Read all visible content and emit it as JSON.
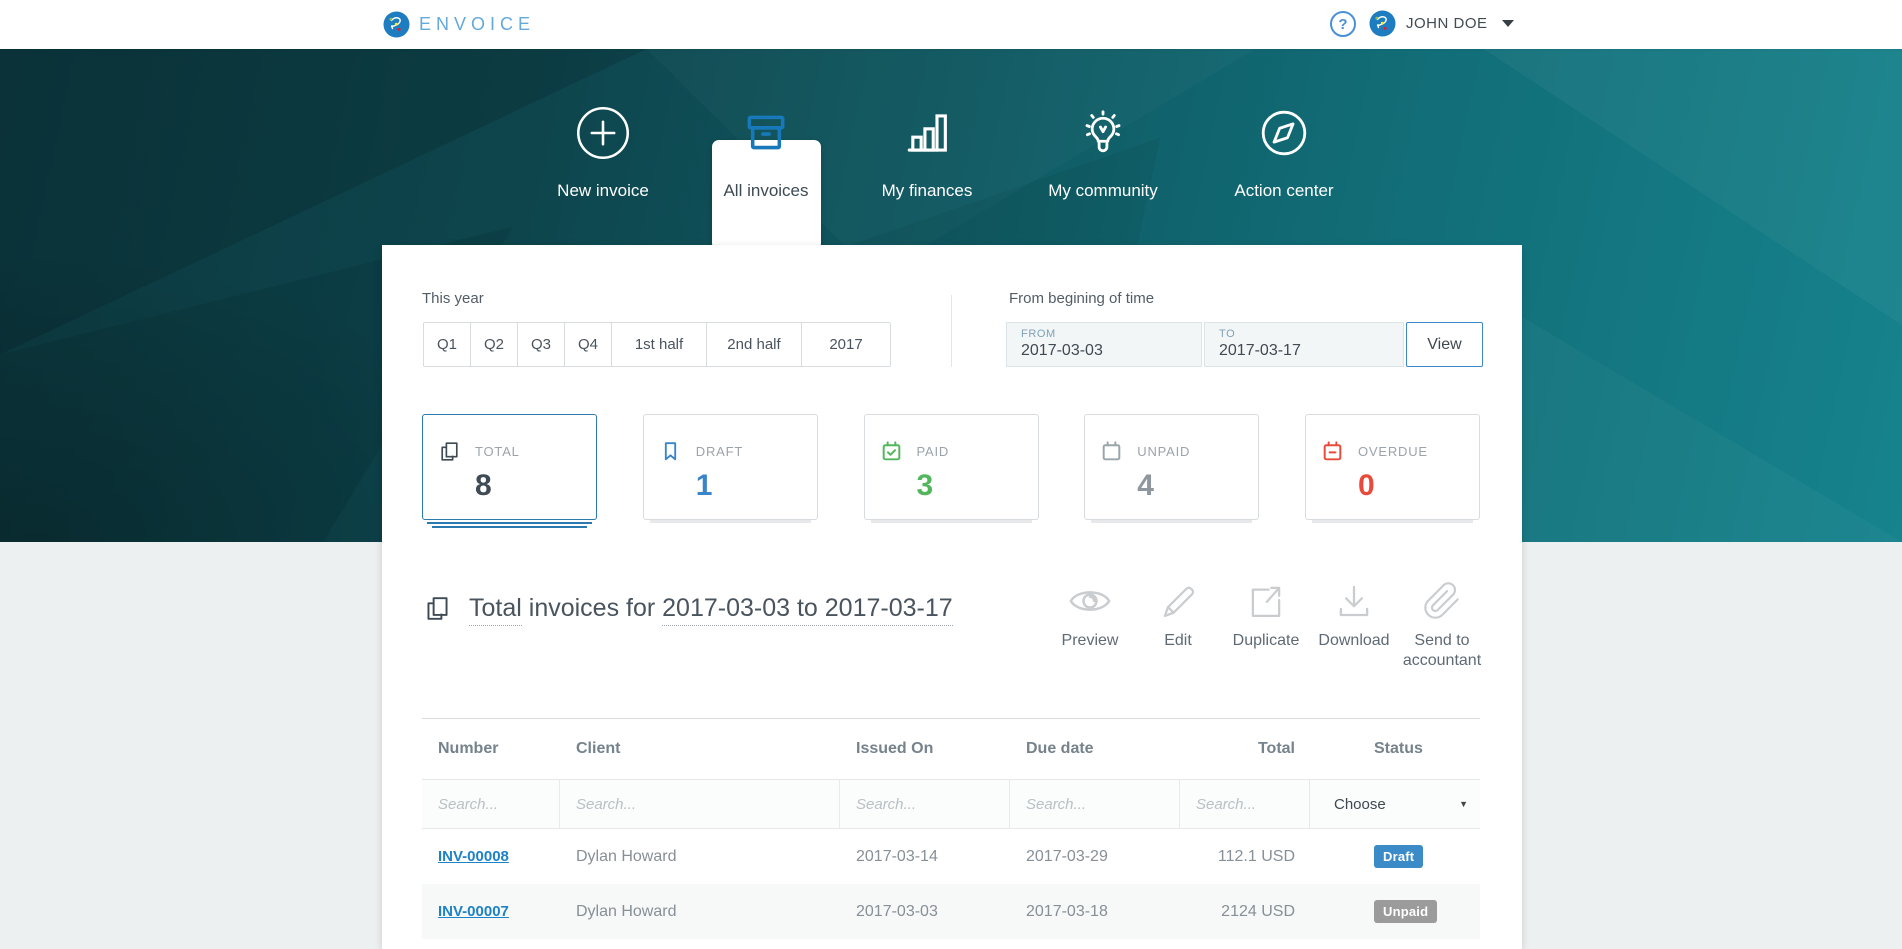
{
  "header": {
    "brand": "ENVOICE",
    "help_icon": "?",
    "user_name": "JOHN DOE"
  },
  "nav": {
    "items": [
      {
        "label": "New invoice",
        "icon": "plus-circle-icon",
        "active": false
      },
      {
        "label": "All invoices",
        "icon": "archive-box-icon",
        "active": true
      },
      {
        "label": "My finances",
        "icon": "bar-chart-icon",
        "active": false
      },
      {
        "label": "My community",
        "icon": "lightbulb-icon",
        "active": false
      },
      {
        "label": "Action center",
        "icon": "compass-icon",
        "active": false
      }
    ]
  },
  "filters": {
    "preset_label": "This year",
    "periods": [
      "Q1",
      "Q2",
      "Q3",
      "Q4",
      "1st half",
      "2nd half",
      "2017"
    ],
    "range_label": "From begining of time",
    "from": {
      "label": "FROM",
      "value": "2017-03-03"
    },
    "to": {
      "label": "TO",
      "value": "2017-03-17"
    },
    "view_button": "View"
  },
  "summary_cards": [
    {
      "label": "TOTAL",
      "value": "8",
      "icon": "copy-pages-icon",
      "color": "#3e4b54",
      "selected": true
    },
    {
      "label": "DRAFT",
      "value": "1",
      "icon": "bookmark-icon",
      "color": "#3a85c8",
      "selected": false
    },
    {
      "label": "PAID",
      "value": "3",
      "icon": "calendar-check-icon",
      "color": "#52b65c",
      "selected": false
    },
    {
      "label": "UNPAID",
      "value": "4",
      "icon": "calendar-icon",
      "color": "#8f979e",
      "selected": false
    },
    {
      "label": "OVERDUE",
      "value": "0",
      "icon": "calendar-minus-icon",
      "color": "#e84b3c",
      "selected": false
    }
  ],
  "content": {
    "title": {
      "prefix": "Total",
      "middle": " invoices for ",
      "range": "2017-03-03 to 2017-03-17"
    },
    "actions": [
      {
        "label": "Preview",
        "icon": "eye-icon"
      },
      {
        "label": "Edit",
        "icon": "pencil-icon"
      },
      {
        "label": "Duplicate",
        "icon": "duplicate-icon"
      },
      {
        "label": "Download",
        "icon": "download-icon"
      },
      {
        "label": "Send to accountant",
        "icon": "paperclip-icon"
      }
    ]
  },
  "table": {
    "columns": [
      "Number",
      "Client",
      "Issued On",
      "Due date",
      "Total",
      "Status"
    ],
    "search_placeholder": "Search...",
    "status_filter": "Choose",
    "rows": [
      {
        "number": "INV-00008",
        "client": "Dylan Howard",
        "issued_on": "2017-03-14",
        "due_date": "2017-03-29",
        "total": "112.1 USD",
        "status": "Draft"
      },
      {
        "number": "INV-00007",
        "client": "Dylan Howard",
        "issued_on": "2017-03-03",
        "due_date": "2017-03-18",
        "total": "2124 USD",
        "status": "Unpaid"
      }
    ]
  },
  "colors": {
    "accent_blue": "#1779ba",
    "link_blue": "#1d82c6",
    "badge_draft": "#3a8bc8",
    "badge_unpaid": "#9b9b9b",
    "paid_green": "#52b65c",
    "overdue_red": "#e84b3c",
    "hero_teal_dark": "#0c3940",
    "hero_teal_light": "#16838d"
  }
}
